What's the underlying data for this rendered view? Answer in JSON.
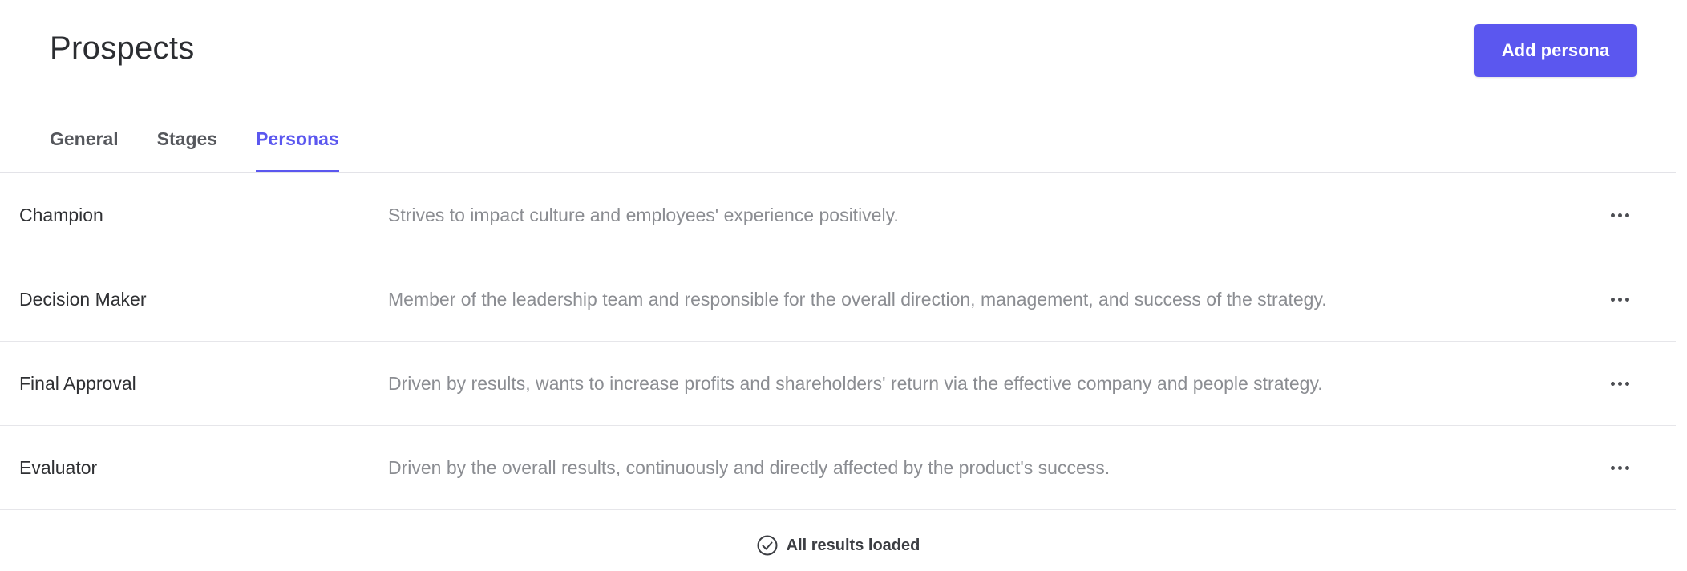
{
  "header": {
    "title": "Prospects",
    "add_button_label": "Add persona"
  },
  "tabs": [
    {
      "label": "General",
      "active": false
    },
    {
      "label": "Stages",
      "active": false
    },
    {
      "label": "Personas",
      "active": true
    }
  ],
  "personas": [
    {
      "name": "Champion",
      "description": "Strives to impact culture and employees' experience positively."
    },
    {
      "name": "Decision Maker",
      "description": "Member of the leadership team and responsible for the overall direction, management, and success of the strategy."
    },
    {
      "name": "Final Approval",
      "description": "Driven by results, wants to increase profits and shareholders' return via the effective company and people strategy."
    },
    {
      "name": "Evaluator",
      "description": "Driven by the overall results, continuously and directly affected by the product's success."
    }
  ],
  "footer": {
    "status_text": "All results loaded",
    "status_icon": "check-circle-icon"
  },
  "colors": {
    "accent": "#5b57ef",
    "muted_text": "#8b8d92",
    "divider": "#e6e6ea"
  },
  "icons": {
    "row_menu": "more-horizontal-icon"
  }
}
